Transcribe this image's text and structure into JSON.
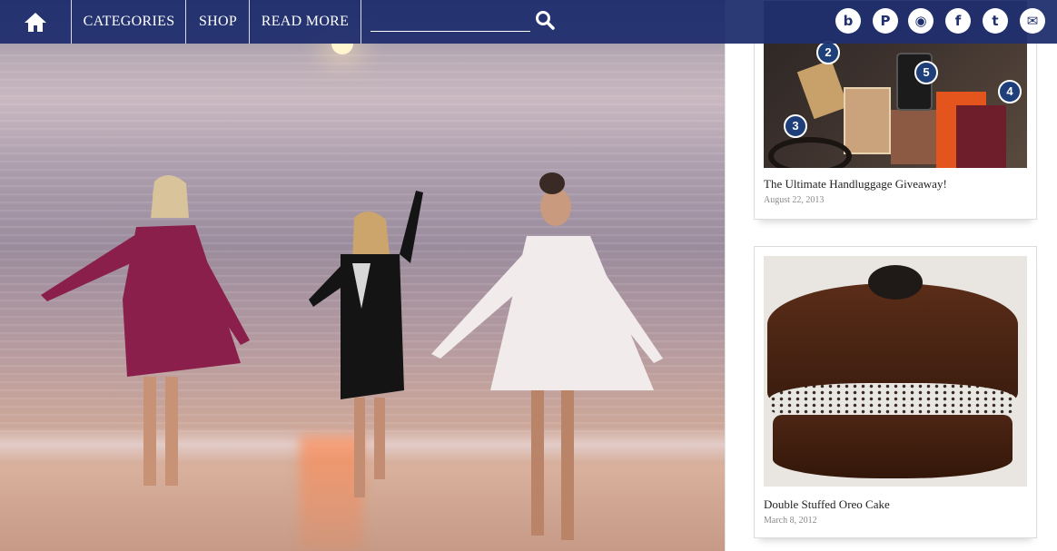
{
  "nav": {
    "home_icon": "home-icon",
    "items": [
      {
        "label": "CATEGORIES"
      },
      {
        "label": "SHOP"
      },
      {
        "label": "READ MORE"
      }
    ],
    "search": {
      "placeholder": "",
      "value": "",
      "icon": "search-icon"
    },
    "social": [
      {
        "name": "blog-logo-icon",
        "glyph": "b"
      },
      {
        "name": "pinterest-icon",
        "glyph": "P"
      },
      {
        "name": "instagram-icon",
        "glyph": "◉"
      },
      {
        "name": "facebook-icon",
        "glyph": "f"
      },
      {
        "name": "twitter-icon",
        "glyph": "t"
      },
      {
        "name": "email-icon",
        "glyph": "✉"
      }
    ],
    "bar_color": "#202e6e"
  },
  "sidebar": {
    "posts": [
      {
        "title": "The Ultimate Handluggage Giveaway!",
        "date": "August 22, 2013",
        "badges": [
          "2",
          "3",
          "4",
          "5"
        ]
      },
      {
        "title": "Double Stuffed Oreo Cake",
        "date": "March 8, 2012"
      }
    ]
  }
}
